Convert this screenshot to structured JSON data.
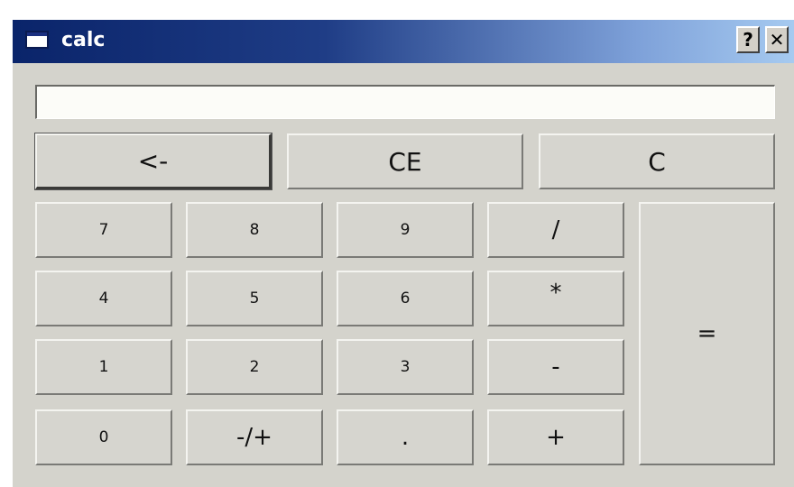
{
  "window": {
    "title": "calc",
    "help_label": "?",
    "close_label": "✕"
  },
  "display": {
    "value": ""
  },
  "controls": {
    "backspace": "<-",
    "clear_entry": "CE",
    "clear": "C"
  },
  "keys": {
    "k7": "7",
    "k8": "8",
    "k9": "9",
    "div": "/",
    "k4": "4",
    "k5": "5",
    "k6": "6",
    "mul": "*",
    "k1": "1",
    "k2": "2",
    "k3": "3",
    "sub": "-",
    "k0": "0",
    "sign": "-/+",
    "dot": ".",
    "add": "+",
    "equals": "="
  }
}
